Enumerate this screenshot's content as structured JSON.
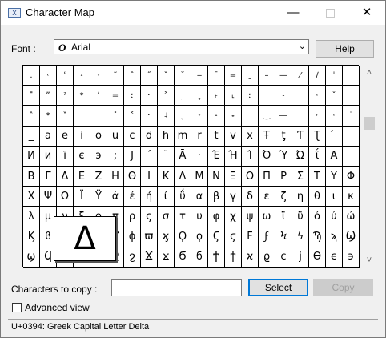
{
  "window": {
    "title": "Character Map",
    "controls": {
      "minimize": "—",
      "close": "✕"
    }
  },
  "font": {
    "label": "Font :",
    "icon_glyph": "O",
    "value": "Arial",
    "chevron": "⌄"
  },
  "help_label": "Help",
  "grid": {
    "rows": [
      [
        ".",
        "˓",
        "ʿ",
        "˔",
        "˕",
        "˜",
        "ˆ",
        "˝",
        "ˇ",
        "˘",
        "‒",
        "¯",
        "=",
        "ˍ",
        "–",
        "—",
        "⁄",
        "∕",
        "ˈ",
        ""
      ],
      [
        "˭",
        "ˮ",
        "ˀ",
        "*",
        "ʼ",
        "=",
        "ː",
        "ˑ",
        "˃",
        "˷",
        "˳",
        "˫",
        "˪",
        "ː",
        "",
        "˗",
        "",
        "˓",
        "ˇ",
        ""
      ],
      [
        "˄",
        "*",
        "˅",
        "",
        "",
        "˟",
        "˂",
        "ˑ",
        "˨",
        "ˎ",
        "˕",
        "˔",
        "˖",
        "",
        "‿",
        "―",
        "",
        "˒",
        "˓",
        "˙"
      ],
      [
        "_",
        "a",
        "e",
        "i",
        "o",
        "u",
        "c",
        "d",
        "h",
        "m",
        "r",
        "t",
        "v",
        "x",
        "Ŧ",
        "ƫ",
        "Ƭ",
        "Ʈ",
        "́",
        ""
      ],
      [
        "И",
        "и",
        "ї",
        "є",
        "э",
        ";",
        "Ј",
        "´",
        "¨",
        "Ā",
        "·",
        "Έ",
        "Ή",
        "Ί",
        "Ό",
        "Ύ",
        "Ώ",
        "ΐ",
        "Α",
        ""
      ],
      [
        "Β",
        "Γ",
        "Δ",
        "Ε",
        "Z",
        "H",
        "Θ",
        "I",
        "K",
        "Λ",
        "M",
        "N",
        "Ξ",
        "O",
        "Π",
        "P",
        "Σ",
        "T",
        "Y",
        "Φ"
      ],
      [
        "X",
        "Ψ",
        "Ω",
        "Ϊ",
        "Ϋ",
        "ά",
        "έ",
        "ή",
        "ί",
        "ΰ",
        "α",
        "β",
        "γ",
        "δ",
        "ε",
        "ζ",
        "η",
        "θ",
        "ι",
        "κ"
      ],
      [
        "λ",
        "μ",
        "ν",
        "ξ",
        "ο",
        "π",
        "ρ",
        "ς",
        "σ",
        "τ",
        "υ",
        "φ",
        "χ",
        "ψ",
        "ω",
        "ϊ",
        "ϋ",
        "ό",
        "ύ",
        "ώ"
      ],
      [
        "Ϗ",
        "ϐ",
        "ϑ",
        "ϒ",
        "ϓ",
        "ϔ",
        "ϕ",
        "ϖ",
        "ϗ",
        "Ϙ",
        "ϙ",
        "Ϛ",
        "ϛ",
        "Ϝ",
        "ϝ",
        "Ϟ",
        "ϟ",
        "Ϡ",
        "ϡ",
        "Ϣ"
      ],
      [
        "ϣ",
        "Ϥ",
        "ϥ",
        "Ϧ",
        "ϧ",
        "Ϩ",
        "ϩ",
        "Ϫ",
        "ϫ",
        "Ϭ",
        "ϭ",
        "Ϯ",
        "ϯ",
        "ϰ",
        "ϱ",
        "ϲ",
        "ϳ",
        "ϴ",
        "ϵ",
        "϶"
      ]
    ],
    "selected_char": "Δ",
    "scroll_up": "˄",
    "scroll_down": "˅"
  },
  "copy": {
    "label": "Characters to copy :",
    "value": "",
    "select_label": "Select",
    "copy_label": "Copy"
  },
  "advanced_view_label": "Advanced view",
  "status_text": "U+0394: Greek Capital Letter Delta"
}
